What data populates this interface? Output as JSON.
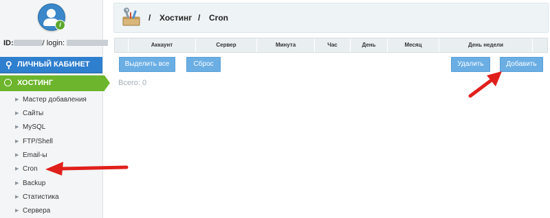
{
  "sidebar": {
    "user": {
      "id_label": "ID:",
      "login_label": "/ login:"
    },
    "cabinet_label": "ЛИЧНЫЙ КАБИНЕТ",
    "hosting_label": "ХОСТИНГ",
    "items": [
      {
        "label": "Мастер добавления"
      },
      {
        "label": "Сайты"
      },
      {
        "label": "MySQL"
      },
      {
        "label": "FTP/Shell"
      },
      {
        "label": "Email-ы"
      },
      {
        "label": "Cron"
      },
      {
        "label": "Backup"
      },
      {
        "label": "Статистика"
      },
      {
        "label": "Сервера"
      }
    ]
  },
  "breadcrumb": {
    "sep": "/",
    "hosting": "Хостинг",
    "current": "Cron"
  },
  "table": {
    "columns": [
      "Аккаунт",
      "Сервер",
      "Минута",
      "Час",
      "День",
      "Месяц",
      "День недели"
    ]
  },
  "toolbar": {
    "select_all": "Выделить все",
    "reset": "Сброс",
    "delete": "Удалить",
    "add": "Добавить"
  },
  "total_text": "Всего: 0",
  "colors": {
    "cabinet_bg": "#2f7fcf",
    "hosting_bg": "#6cb52c",
    "button_bg": "#6aaee4",
    "annotation_arrow": "#e0201b"
  }
}
